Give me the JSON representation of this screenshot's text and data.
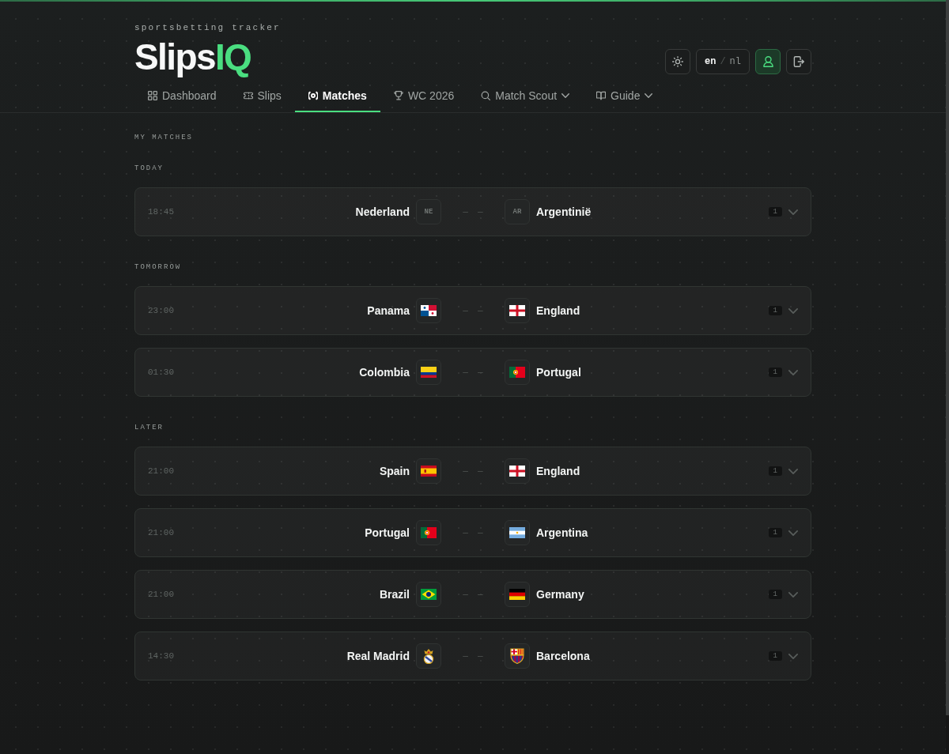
{
  "header": {
    "tagline": "sportsbetting tracker",
    "logo": {
      "main": "Slips",
      "accent": "IQ"
    },
    "actions": [
      {
        "kind": "theme",
        "active": false
      },
      {
        "kind": "language",
        "options": [
          {
            "label": "en",
            "selected": true
          },
          {
            "label": "nl",
            "selected": false
          }
        ],
        "separator": "/"
      },
      {
        "kind": "profile",
        "active": true
      },
      {
        "kind": "logout",
        "active": false
      }
    ]
  },
  "nav": {
    "tabs": [
      {
        "label": "Dashboard",
        "selected": false,
        "dropdown": false
      },
      {
        "label": "Slips",
        "selected": false,
        "dropdown": false
      },
      {
        "label": "Matches",
        "selected": true,
        "dropdown": false
      },
      {
        "label": "WC 2026",
        "selected": false,
        "dropdown": false
      },
      {
        "label": "Match Scout",
        "selected": false,
        "dropdown": true
      },
      {
        "label": "Guide",
        "selected": false,
        "dropdown": true
      }
    ]
  },
  "page": {
    "title": "MY MATCHES",
    "sections": [
      {
        "title": "TODAY",
        "matches": [
          {
            "time": "18:45",
            "home": {
              "name": "Nederland",
              "kind": "code",
              "code": "NE"
            },
            "home_score": "–",
            "away_score": "–",
            "away": {
              "name": "Argentinië",
              "kind": "code",
              "code": "AR"
            },
            "count": "1",
            "expanded": false
          }
        ]
      },
      {
        "title": "TOMORROW",
        "matches": [
          {
            "time": "23:00",
            "home": {
              "name": "Panama",
              "kind": "emblem"
            },
            "home_score": "–",
            "away_score": "–",
            "away": {
              "name": "England",
              "kind": "emblem"
            },
            "count": "1",
            "expanded": false
          },
          {
            "time": "01:30",
            "home": {
              "name": "Colombia",
              "kind": "emblem"
            },
            "home_score": "–",
            "away_score": "–",
            "away": {
              "name": "Portugal",
              "kind": "emblem"
            },
            "count": "1",
            "expanded": false
          }
        ]
      },
      {
        "title": "LATER",
        "matches": [
          {
            "time": "21:00",
            "home": {
              "name": "Spain",
              "kind": "emblem"
            },
            "home_score": "–",
            "away_score": "–",
            "away": {
              "name": "England",
              "kind": "emblem"
            },
            "count": "1",
            "expanded": false
          },
          {
            "time": "21:00",
            "home": {
              "name": "Portugal",
              "kind": "emblem"
            },
            "home_score": "–",
            "away_score": "–",
            "away": {
              "name": "Argentina",
              "kind": "emblem"
            },
            "count": "1",
            "expanded": false
          },
          {
            "time": "21:00",
            "home": {
              "name": "Brazil",
              "kind": "emblem"
            },
            "home_score": "–",
            "away_score": "–",
            "away": {
              "name": "Germany",
              "kind": "emblem"
            },
            "count": "1",
            "expanded": false
          },
          {
            "time": "14:30",
            "home": {
              "name": "Real Madrid",
              "kind": "emblem"
            },
            "home_score": "–",
            "away_score": "–",
            "away": {
              "name": "Barcelona",
              "kind": "emblem"
            },
            "count": "1",
            "expanded": false
          }
        ]
      }
    ]
  }
}
